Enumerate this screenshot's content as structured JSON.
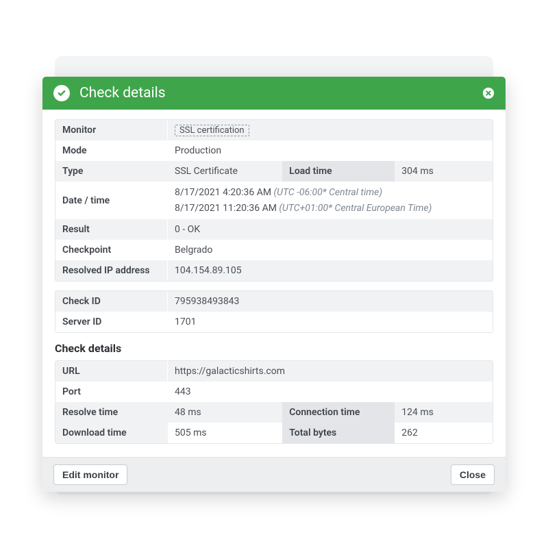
{
  "dialog": {
    "title": "Check details",
    "monitor_label": "Monitor",
    "monitor_value": "SSL certification",
    "mode_label": "Mode",
    "mode_value": "Production",
    "type_label": "Type",
    "type_value": "SSL Certificate",
    "loadtime_label": "Load time",
    "loadtime_value": "304 ms",
    "datetime_label": "Date / time",
    "dt1_val": "8/17/2021 4:20:36 AM ",
    "dt1_tz": "(UTC -06:00* Central time)",
    "dt2_val": "8/17/2021 11:20:36 AM ",
    "dt2_tz": "(UTC+01:00* Central European Time)",
    "result_label": "Result",
    "result_value": "0 - OK",
    "checkpoint_label": "Checkpoint",
    "checkpoint_value": "Belgrado",
    "resolvedip_label": "Resolved IP address",
    "resolvedip_value": "104.154.89.105",
    "checkid_label": "Check ID",
    "checkid_value": "795938493843",
    "serverid_label": "Server ID",
    "serverid_value": "1701",
    "section_title": "Check details",
    "url_label": "URL",
    "url_value": "https://galacticshirts.com",
    "port_label": "Port",
    "port_value": "443",
    "resolvetime_label": "Resolve time",
    "resolvetime_value": "48 ms",
    "conntime_label": "Connection time",
    "conntime_value": "124 ms",
    "dltime_label": "Download time",
    "dltime_value": "505 ms",
    "totalbytes_label": "Total bytes",
    "totalbytes_value": "262"
  },
  "footer": {
    "edit": "Edit monitor",
    "close": "Close"
  }
}
